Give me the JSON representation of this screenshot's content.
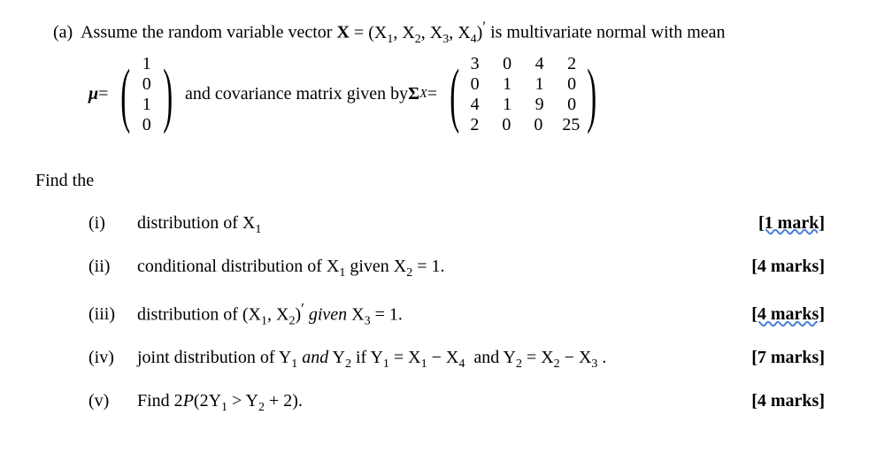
{
  "part_label": "(a)",
  "intro_text_1": "Assume the random variable vector ",
  "X_def": "X = (X₁, X₂, X₃, X₄)′",
  "intro_text_2": " is multivariate normal with mean",
  "mu_label": "μ =",
  "mu_vector": [
    "1",
    "0",
    "1",
    "0"
  ],
  "and_text": " and covariance matrix given by ",
  "sigma_label": "Σ",
  "sigma_sub": "X",
  "eq_text": " = ",
  "cov_matrix": [
    [
      "3",
      "0",
      "4",
      "2"
    ],
    [
      "0",
      "1",
      "1",
      "0"
    ],
    [
      "4",
      "1",
      "9",
      "0"
    ],
    [
      "2",
      "0",
      "0",
      "25"
    ]
  ],
  "find_the": "Find the",
  "items": [
    {
      "roman": "(i)",
      "text": "distribution of X₁",
      "marks": "[1 mark]",
      "wavy": true
    },
    {
      "roman": "(ii)",
      "text": "conditional distribution of X₁ given X₂ = 1.",
      "marks": "[4 marks]",
      "wavy": false
    },
    {
      "roman": "(iii)",
      "text_pre": "distribution of (X₁, X₂)′ ",
      "text_it": "given",
      "text_post": " X₃ = 1.",
      "marks": "[4 marks]",
      "wavy": true
    },
    {
      "roman": "(iv)",
      "text_pre": "joint distribution of Y₁ ",
      "text_it1": "and",
      "text_mid": " Y₂ if Y₁ = X₁ − X₄  and Y₂ = X₂ − X₃ .",
      "marks": "[7 marks]",
      "wavy": false
    },
    {
      "roman": "(v)",
      "text": "Find 2P(2Y₁ > Y₂ + 2).",
      "marks": "[4 marks]",
      "wavy": false
    }
  ]
}
